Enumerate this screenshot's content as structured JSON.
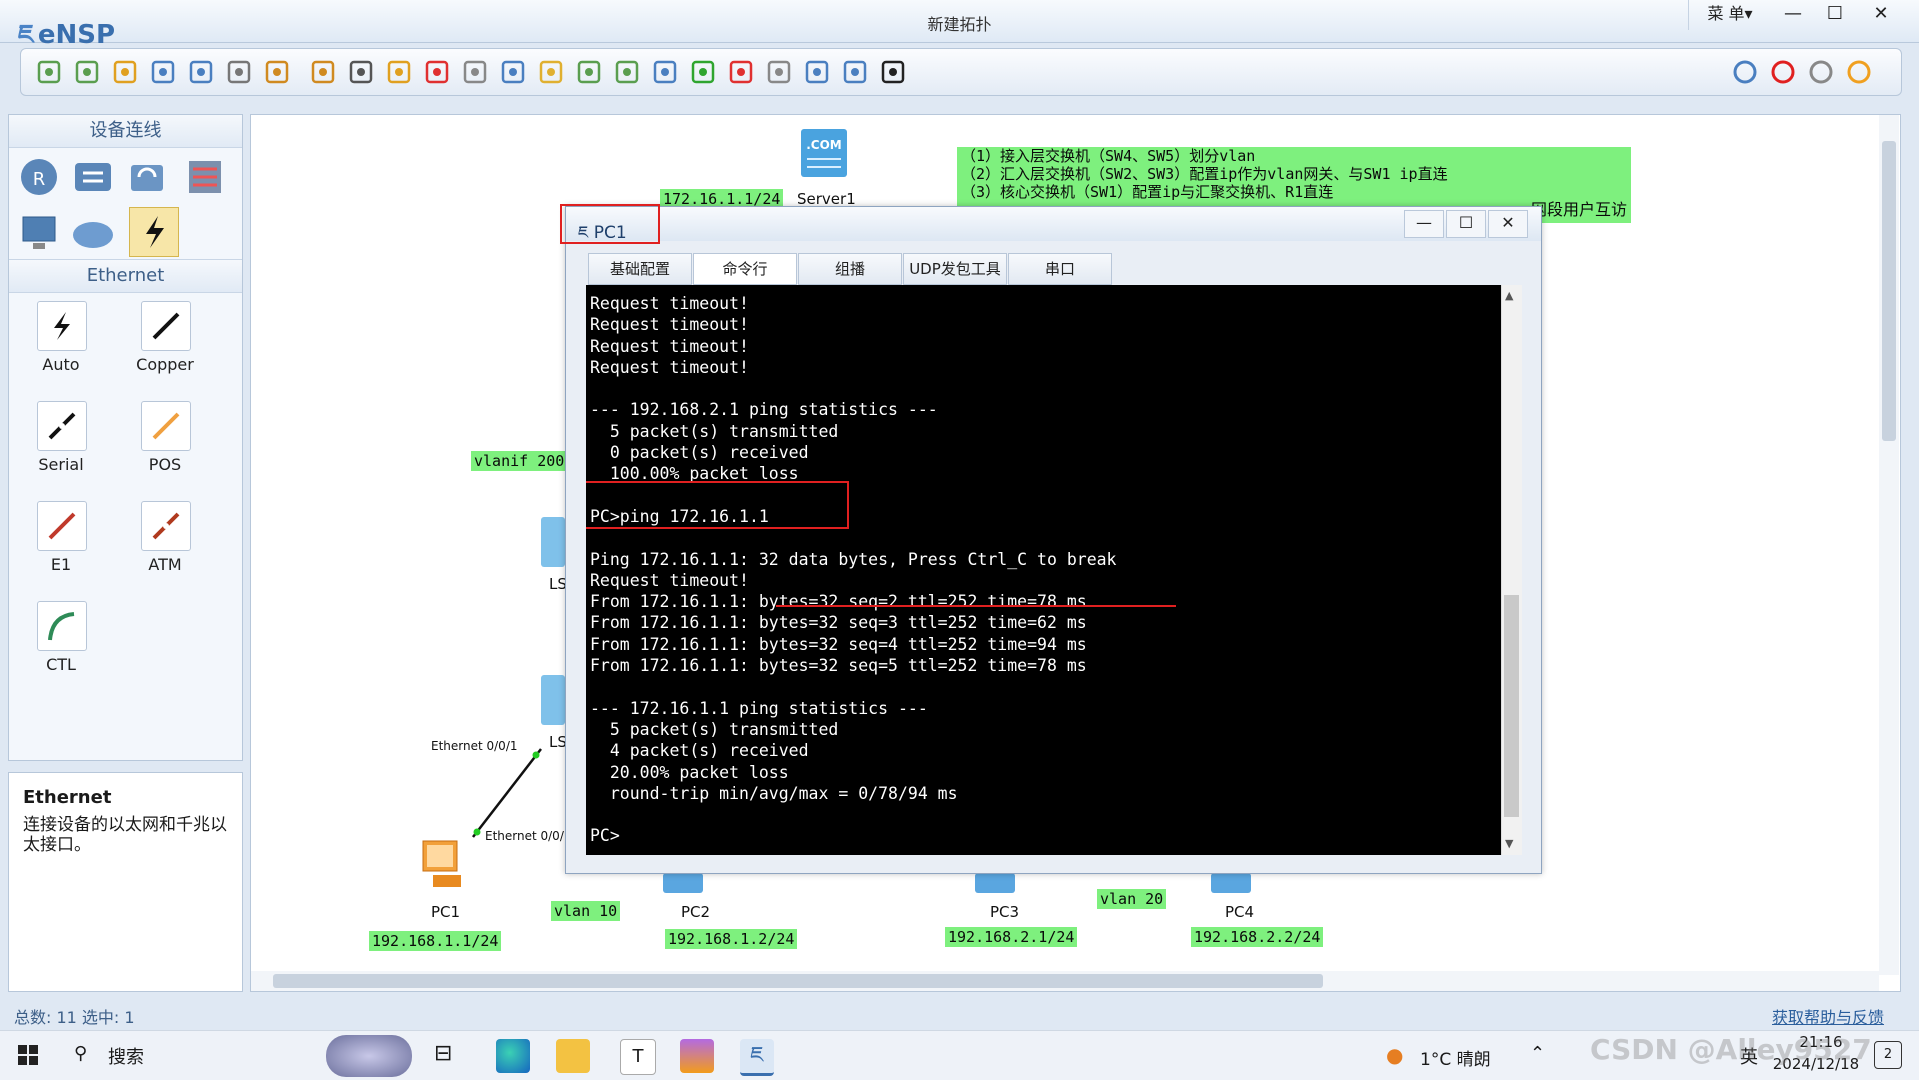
{
  "app": {
    "name": "eNSP",
    "window_title": "新建拓扑",
    "menu_label": "菜 单▾"
  },
  "palette": {
    "section1_title": "设备连线",
    "section2_title": "Ethernet",
    "links": [
      "Auto",
      "Copper",
      "Serial",
      "POS",
      "E1",
      "ATM",
      "CTL"
    ],
    "info_title": "Ethernet",
    "info_desc": "连接设备的以太网和千兆以太接口。"
  },
  "canvas": {
    "notes": [
      "（1）接入层交换机（SW4、SW5）划分vlan",
      "（2）汇入层交换机（SW2、SW3）配置ip作为vlan网关、与SW1 ip直连",
      "（3）核心交换机（SW1）配置ip与汇聚交换机、R1直连",
      "网段用户互访"
    ],
    "server_ip": "172.16.1.1/24",
    "server_name": "Server1",
    "vlanif_label": "vlanif 200",
    "port_label_1": "Ethernet 0/0/1",
    "port_label_2": "Ethernet 0/0/",
    "ls_label": "LS",
    "vlan10": "vlan 10",
    "vlan20": "vlan 20",
    "pcs": [
      {
        "name": "PC1",
        "ip": "192.168.1.1/24"
      },
      {
        "name": "PC2",
        "ip": "192.168.1.2/24"
      },
      {
        "name": "PC3",
        "ip": "192.168.2.1/24"
      },
      {
        "name": "PC4",
        "ip": "192.168.2.2/24"
      }
    ]
  },
  "pc_window": {
    "title": "PC1",
    "tabs": [
      "基础配置",
      "命令行",
      "组播",
      "UDP发包工具",
      "串口"
    ],
    "active_tab": "命令行",
    "terminal": "Request timeout!\nRequest timeout!\nRequest timeout!\nRequest timeout!\n\n--- 192.168.2.1 ping statistics ---\n  5 packet(s) transmitted\n  0 packet(s) received\n  100.00% packet loss\n\nPC>ping 172.16.1.1\n\nPing 172.16.1.1: 32 data bytes, Press Ctrl_C to break\nRequest timeout!\nFrom 172.16.1.1: bytes=32 seq=2 ttl=252 time=78 ms\nFrom 172.16.1.1: bytes=32 seq=3 ttl=252 time=62 ms\nFrom 172.16.1.1: bytes=32 seq=4 ttl=252 time=94 ms\nFrom 172.16.1.1: bytes=32 seq=5 ttl=252 time=78 ms\n\n--- 172.16.1.1 ping statistics ---\n  5 packet(s) transmitted\n  4 packet(s) received\n  20.00% packet loss\n  round-trip min/avg/max = 0/78/94 ms\n\nPC>"
  },
  "status": {
    "left": "总数: 11  选中: 1",
    "right": "获取帮助与反馈"
  },
  "taskbar": {
    "search": "搜索",
    "weather": "1°C 晴朗",
    "ime": "英",
    "time": "21:16",
    "date": "2024/12/18",
    "notif_count": "2",
    "watermark": "CSDN @Alley9527"
  },
  "colors": {
    "accent": "#3a6fae",
    "highlight_red": "#e02020",
    "note_green": "#7ef07e"
  }
}
